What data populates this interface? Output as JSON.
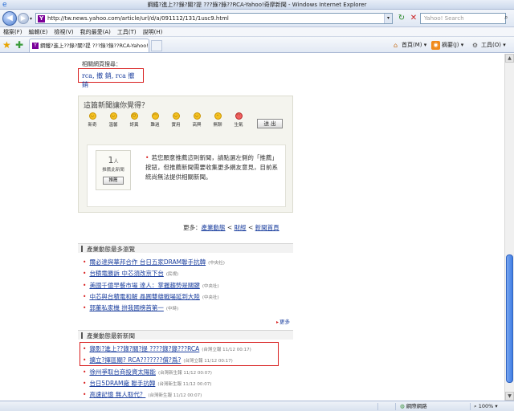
{
  "window": {
    "title": "鋼鐵?進上??錄?關?提 ???錄?錄??RCA-Yahoo!奇摩新聞 - Windows Internet Explorer"
  },
  "address_bar": {
    "url": "http://tw.news.yahoo.com/article/url/d/a/091112/131/1usc9.html",
    "search_placeholder": "Yahoo! Search"
  },
  "menu": [
    "檔案(F)",
    "編輯(E)",
    "檢視(V)",
    "我的最愛(A)",
    "工具(T)",
    "說明(H)"
  ],
  "tab": {
    "label": "鋼鐵?進上??錄?關?提 ???錄?錄??RCA-Yahoo!..."
  },
  "command_bar": {
    "home_label": "首頁(M)",
    "feeds_label": "摘要(J)",
    "tools_label": "工具(O)"
  },
  "related": {
    "label": "相關網頁搜尋：",
    "keywords": "rca, 撤 銷, rca 撤銷"
  },
  "rating": {
    "title": "這篇新聞讓你覺得？",
    "faces": [
      "新奇",
      "溫馨",
      "訝異",
      "難過",
      "實用",
      "高興",
      "無聊",
      "生氣"
    ],
    "submit_label": "送 出"
  },
  "recommend": {
    "count": "1",
    "count_unit": "人",
    "count_label": "推薦此新聞",
    "button_label": "推薦",
    "text": "若您願意推薦這則新聞，請點選左側的「推薦」按鈕，但推薦新聞需要收集更多網友意見，目前系統尚無法提供相關新聞。"
  },
  "more_row": {
    "prefix": "更多：",
    "link1": "產業動態",
    "sep1": " < ",
    "link2": "財經",
    "sep2": " < ",
    "link3": "新聞首頁"
  },
  "section_popular": {
    "title": "產業動態最多瀏覽",
    "items": [
      {
        "text": "爾必達與華邦合作 台日五家DRAM聯手抗韓",
        "source": "(中央社)"
      },
      {
        "text": "台積電勝訴 中芯須改京下台",
        "source": "(民視)"
      },
      {
        "text": "美國千億早餐市場 達人：掌握趨勢是關鍵",
        "source": "(中央社)"
      },
      {
        "text": "中芯與台積電和解 晶圓雙雄戰場延到大陸",
        "source": "(中央社)"
      },
      {
        "text": "郭董私家機 拚我國榜首第一",
        "source": "(中時)"
      }
    ],
    "more_label": "更多"
  },
  "section_latest": {
    "title": "產業動態最新新聞",
    "items": [
      {
        "text": "錄影?進上??錄?關?提 ????錄?錄???RCA",
        "source": "(台灣立報 11/12 00:17)"
      },
      {
        "text": "擴立?擇區關? RCA???????償?爲?",
        "source": "(台灣立報 11/12 00:17)"
      },
      {
        "text": "徐州爭取台商投資太陽能",
        "source": "(台灣新生報 11/12 00:07)"
      },
      {
        "text": "台日5DRAM廠 聯手抗韓",
        "source": "(台灣新生報 11/12 00:07)"
      },
      {
        "text": "高速記憶 無人取代？",
        "source": "(台灣新生報 11/12 00:07)"
      }
    ]
  },
  "status": {
    "zone": "網際網路",
    "zoom": "100%"
  }
}
